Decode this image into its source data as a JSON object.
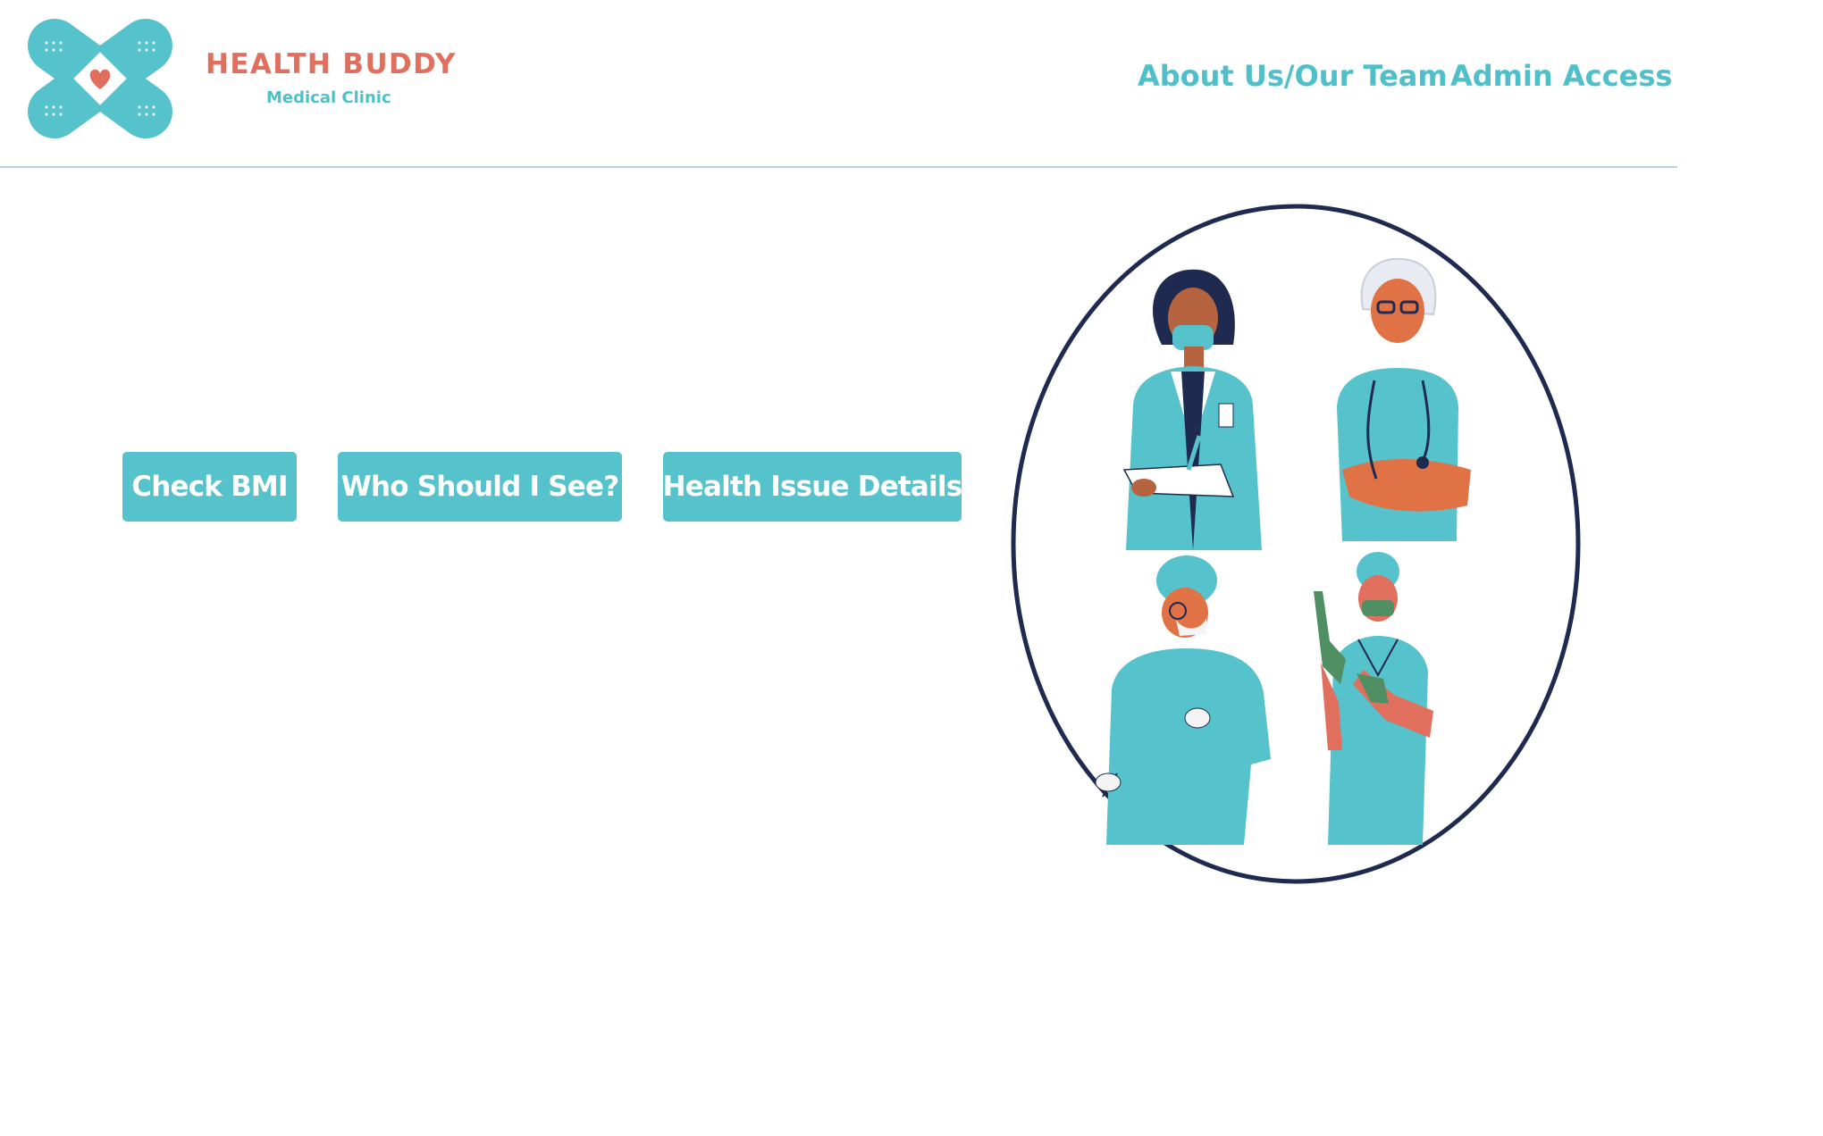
{
  "logo": {
    "title": "HEALTH BUDDY",
    "subtitle": "Medical Clinic"
  },
  "nav": {
    "about": "About Us/Our Team",
    "admin": "Admin Access"
  },
  "actions": {
    "bmi": "Check BMI",
    "who": "Who Should I See?",
    "details": "Health Issue Details"
  },
  "colors": {
    "accent": "#56c2cc",
    "brand_red": "#e06f5e",
    "ring": "#1e2a4f"
  }
}
